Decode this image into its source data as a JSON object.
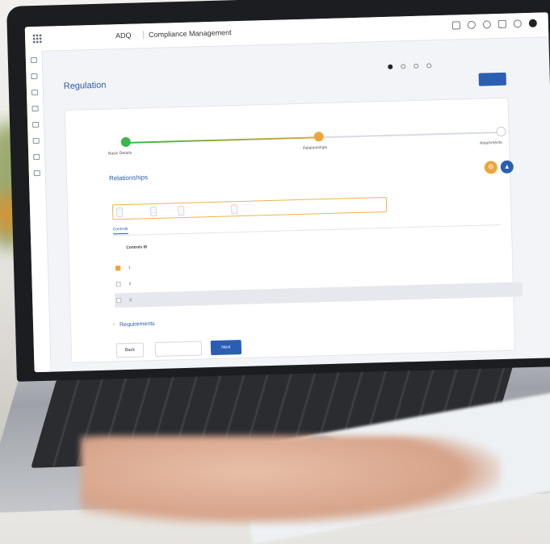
{
  "header": {
    "logo_brand": "",
    "logo_tagline": "",
    "app_short": "ADQ",
    "app_name": "Compliance Management"
  },
  "breadcrumb": "",
  "page_title": "Regulation",
  "legend": [
    "",
    "",
    "",
    ""
  ],
  "save_top": "",
  "progress": {
    "steps": [
      "Basic Details",
      "Relationships",
      "Attachments"
    ]
  },
  "section_title": "Relationships",
  "applicable_label": "",
  "chips": [
    "",
    "",
    "",
    ""
  ],
  "select_all": "",
  "tabs": [
    "Controls",
    "",
    "",
    ""
  ],
  "table": {
    "headers": [
      "Controls ID",
      "",
      "",
      "",
      "",
      ""
    ],
    "rows": [
      {
        "id": "1",
        "title": "",
        "reg": "",
        "req": "",
        "domain": "",
        "owner": ""
      },
      {
        "id": "2",
        "title": "",
        "reg": "",
        "req": "",
        "domain": "",
        "owner": ""
      },
      {
        "id": "3",
        "title": "",
        "reg": "",
        "req": "",
        "domain": "",
        "owner": ""
      }
    ]
  },
  "requirements_label": "Requirements",
  "buttons": {
    "back": "Back",
    "save_exit": "",
    "next": "Next"
  }
}
